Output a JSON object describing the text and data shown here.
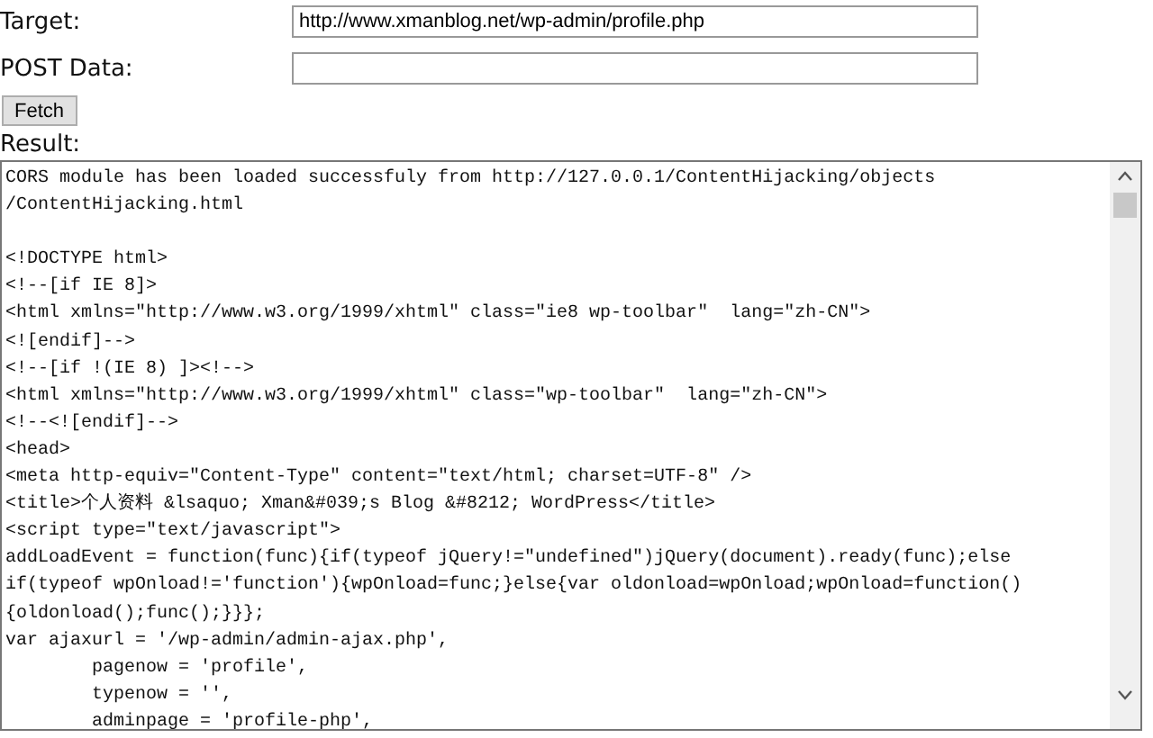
{
  "form": {
    "target_label": "Target:",
    "target_value": "http://www.xmanblog.net/wp-admin/profile.php",
    "post_label": "POST Data:",
    "fetch_button": "Fetch"
  },
  "result": {
    "label": "Result:",
    "blocks": [
      [
        "CORS module has been loaded successfuly from http://127.0.0.1/ContentHijacking/objects",
        "/ContentHijacking.html"
      ],
      [
        "<!DOCTYPE html>",
        "<!--[if IE 8]>",
        "<html xmlns=\"http://www.w3.org/1999/xhtml\" class=\"ie8 wp-toolbar\"  lang=\"zh-CN\">",
        "<![endif]-->",
        "<!--[if !(IE 8) ]><!-->",
        "<html xmlns=\"http://www.w3.org/1999/xhtml\" class=\"wp-toolbar\"  lang=\"zh-CN\">",
        "<!--<![endif]-->",
        "<head>",
        "<meta http-equiv=\"Content-Type\" content=\"text/html; charset=UTF-8\" />",
        "<title>个人资料 &lsaquo; Xman&#039;s Blog &#8212; WordPress</title>",
        "<script type=\"text/javascript\">",
        "addLoadEvent = function(func){if(typeof jQuery!=\"undefined\")jQuery(document).ready(func);else",
        "if(typeof wpOnload!='function'){wpOnload=func;}else{var oldonload=wpOnload;wpOnload=function()",
        "{oldonload();func();}}};",
        "var ajaxurl = '/wp-admin/admin-ajax.php',",
        "        pagenow = 'profile',",
        "        typenow = '',",
        "        adminpage = 'profile-php',"
      ]
    ]
  }
}
